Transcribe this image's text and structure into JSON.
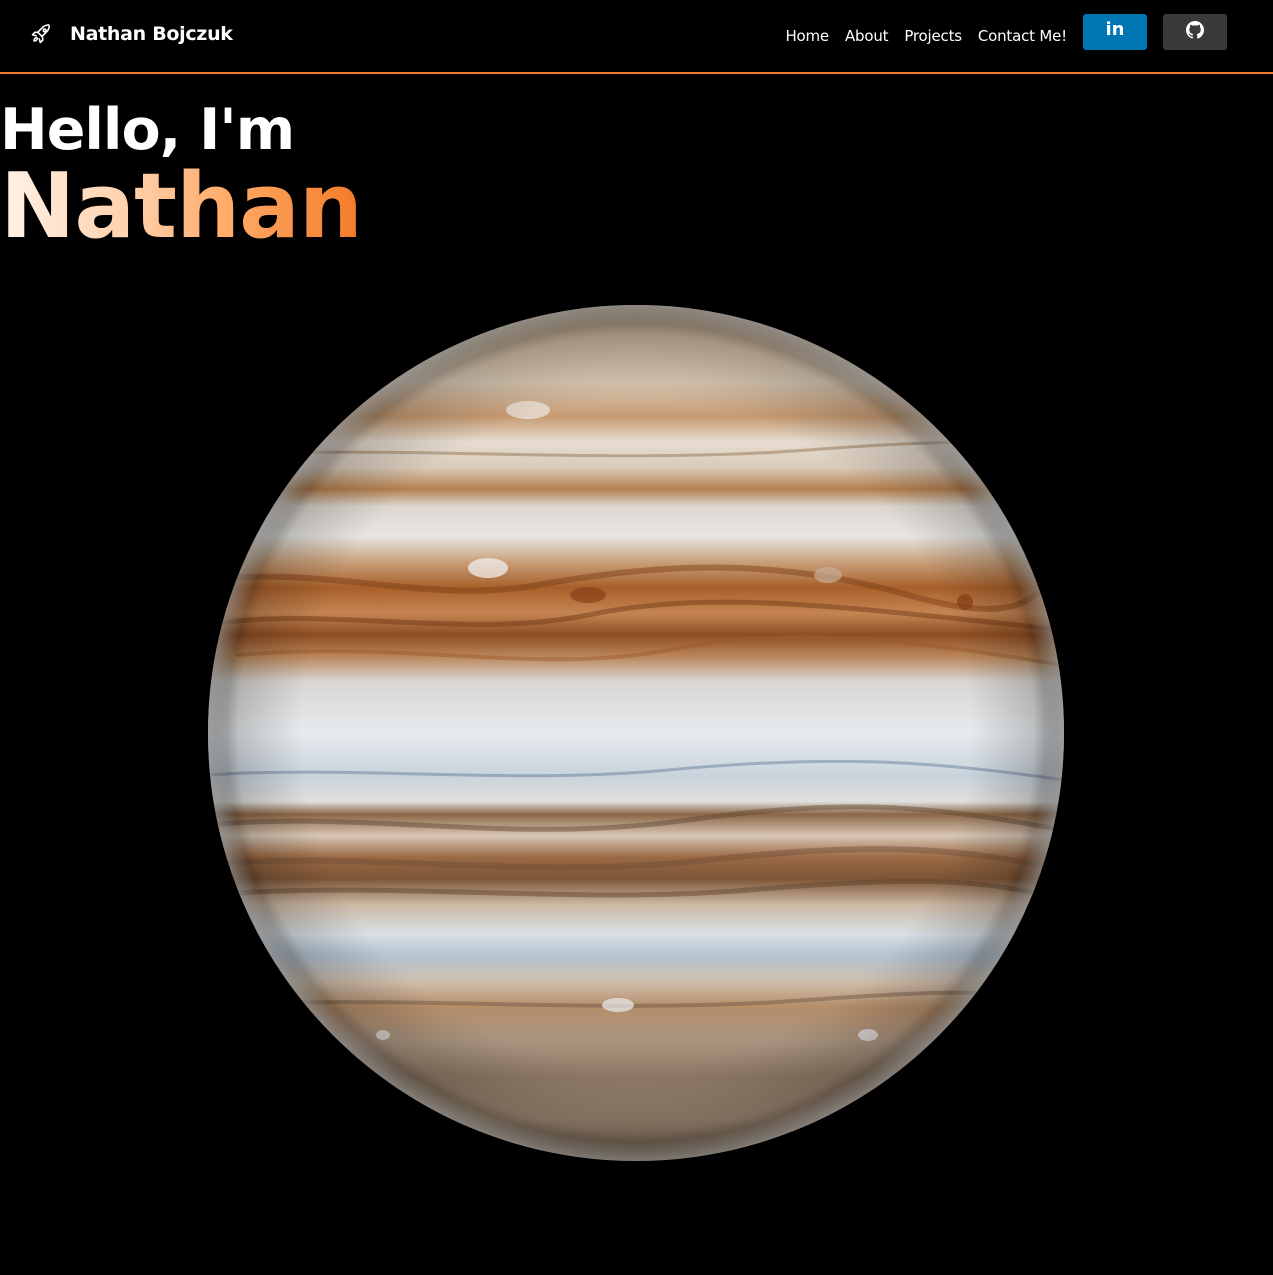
{
  "header": {
    "brand": "Nathan Bojczuk",
    "brand_icon": "rocket-icon",
    "nav": [
      {
        "label": "Home"
      },
      {
        "label": "About"
      },
      {
        "label": "Projects"
      },
      {
        "label": "Contact Me!"
      }
    ],
    "linkedin_label": "in",
    "linkedin_icon": "linkedin-icon",
    "github_icon": "github-icon",
    "accent_color": "#f07a2e",
    "linkedin_color": "#0077b5",
    "github_color": "#3a3a3a"
  },
  "hero": {
    "greeting": "Hello, I'm",
    "name": "Nathan",
    "name_gradient": [
      "#fff3e8",
      "#ffd1ad",
      "#ffa864",
      "#f37a28"
    ],
    "image": "jupiter-planet"
  }
}
